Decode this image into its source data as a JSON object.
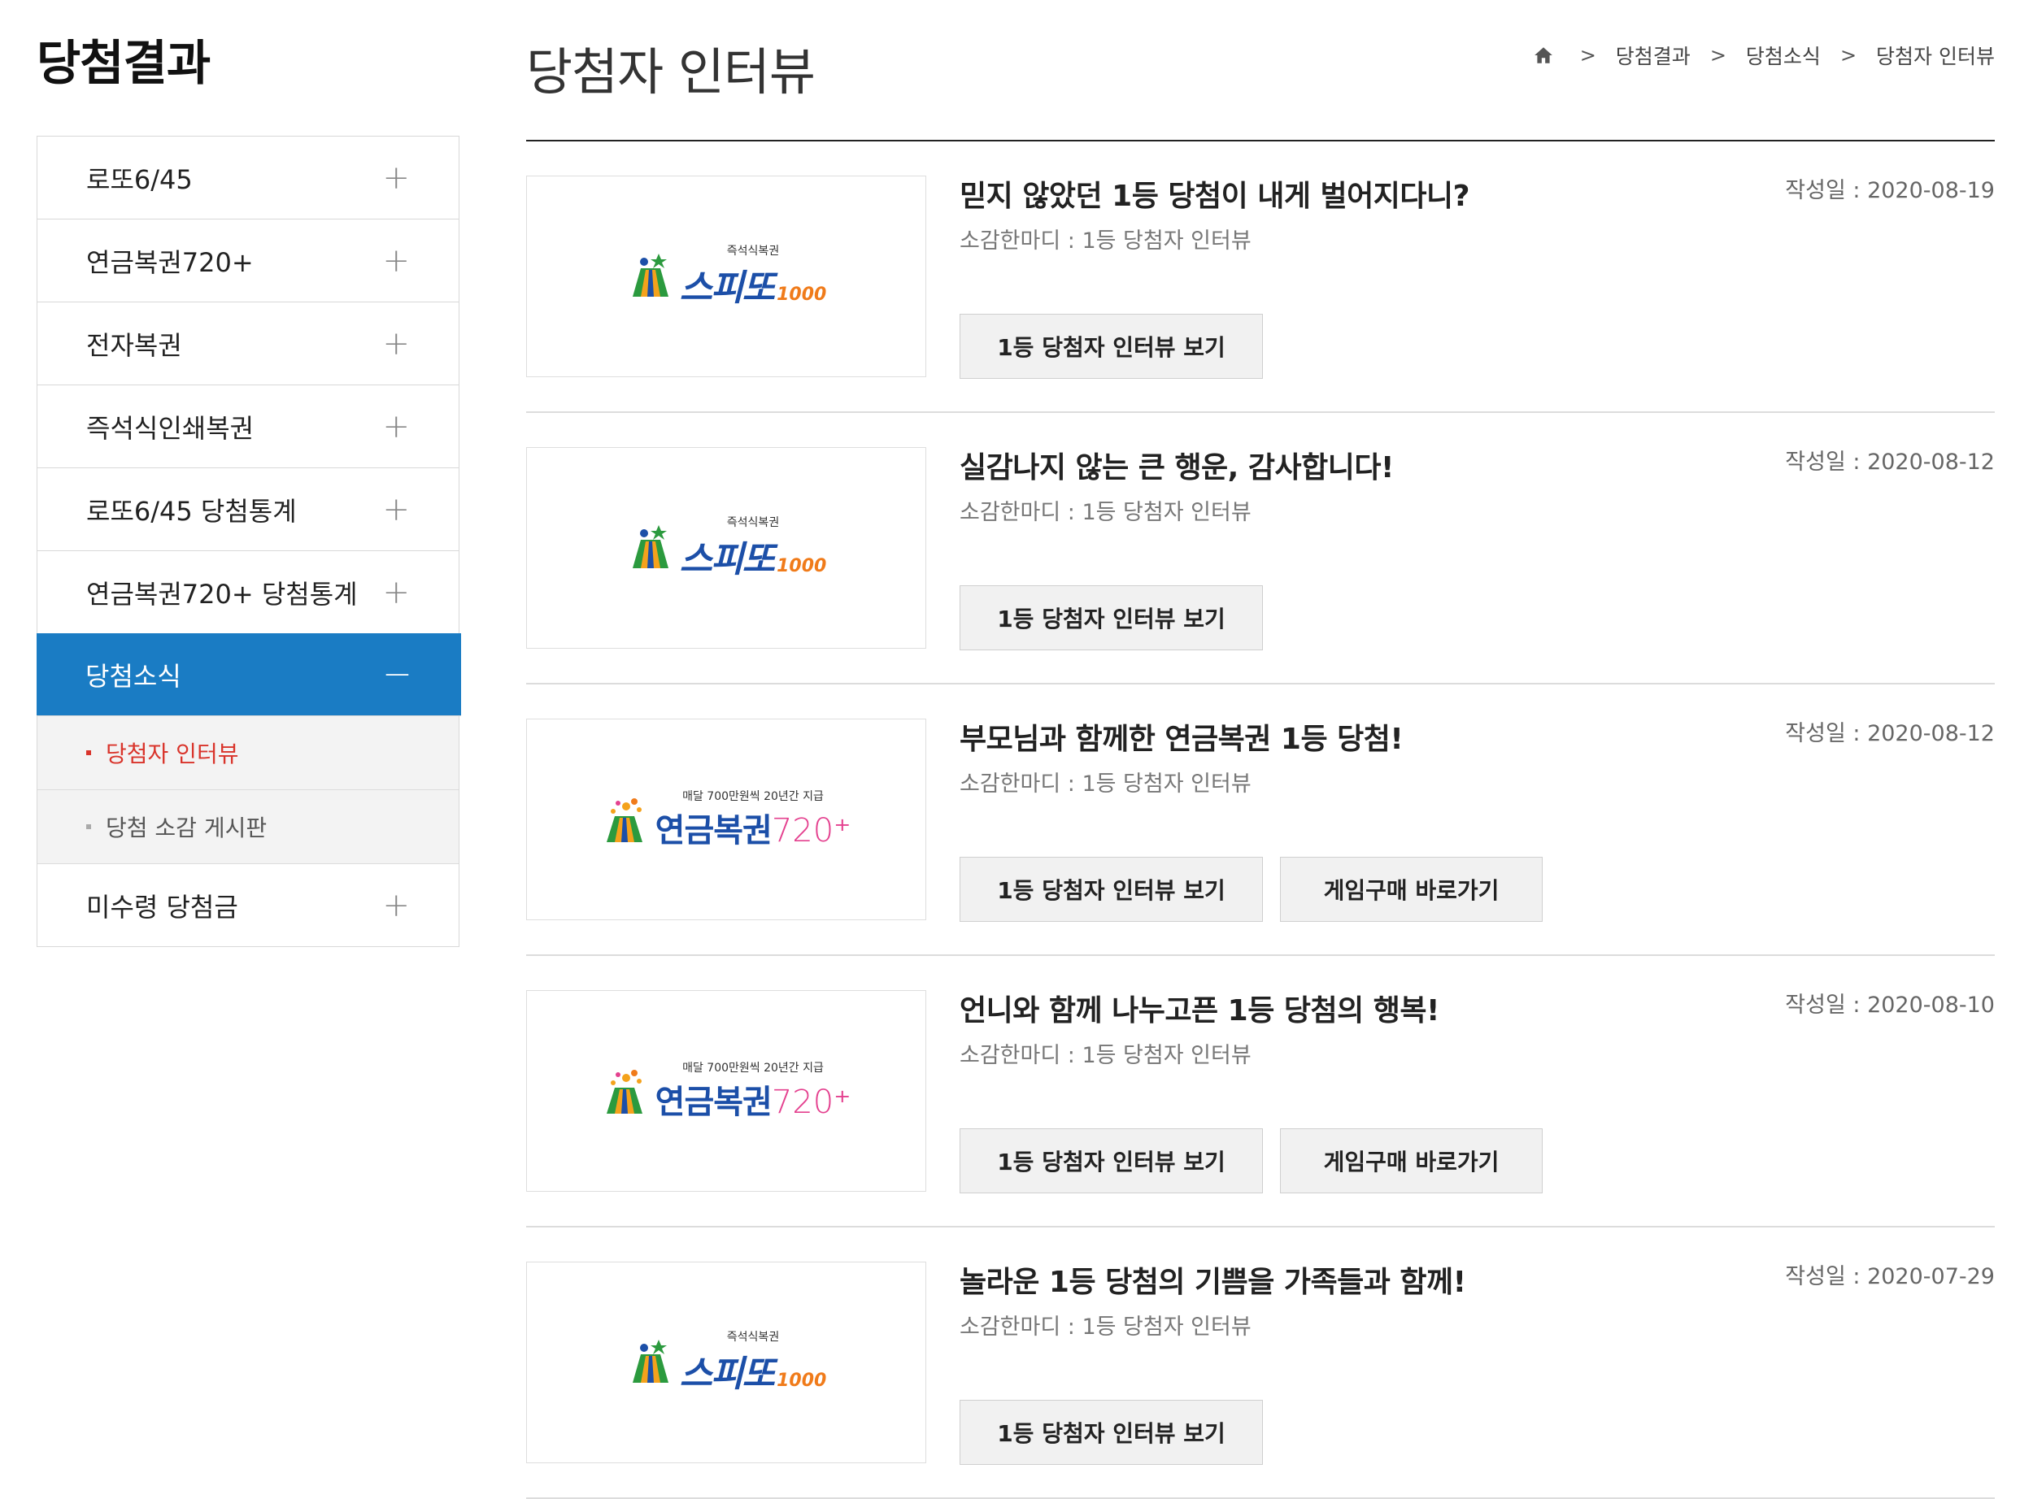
{
  "side_title": "당첨결과",
  "page_title": "당첨자 인터뷰",
  "breadcrumb": {
    "items": [
      "당첨결과",
      "당첨소식",
      "당첨자 인터뷰"
    ]
  },
  "sidebar": {
    "items": [
      {
        "label": "로또6/45"
      },
      {
        "label": "연금복권720+"
      },
      {
        "label": "전자복권"
      },
      {
        "label": "즉석식인쇄복권"
      },
      {
        "label": "로또6/45 당첨통계"
      },
      {
        "label": "연금복권720+ 당첨통계"
      },
      {
        "label": "당첨소식"
      },
      {
        "label": "미수령 당첨금"
      }
    ],
    "sub_items": [
      {
        "label": "당첨자 인터뷰"
      },
      {
        "label": "당첨 소감 게시판"
      }
    ]
  },
  "logos": {
    "speetto": {
      "small": "즉석식복권",
      "big": "스피또",
      "num": "1000"
    },
    "pension": {
      "small": "매달 700만원씩 20년간 지급",
      "big": "연금복권",
      "num": "720⁺"
    }
  },
  "interviews": [
    {
      "title": "믿지 않았던 1등 당첨이 내게 벌어지다니?",
      "sub": "소감한마디 : 1등 당첨자 인터뷰",
      "date": "작성일 : 2020-08-19",
      "btn1": "1등 당첨자 인터뷰 보기",
      "logo": "speetto"
    },
    {
      "title": "실감나지 않는 큰 행운, 감사합니다!",
      "sub": "소감한마디 : 1등 당첨자 인터뷰",
      "date": "작성일 : 2020-08-12",
      "btn1": "1등 당첨자 인터뷰 보기",
      "logo": "speetto"
    },
    {
      "title": "부모님과 함께한 연금복권 1등 당첨!",
      "sub": "소감한마디 : 1등 당첨자 인터뷰",
      "date": "작성일 : 2020-08-12",
      "btn1": "1등 당첨자 인터뷰 보기",
      "btn2": "게임구매 바로가기",
      "logo": "pension"
    },
    {
      "title": "언니와 함께 나누고픈 1등 당첨의 행복!",
      "sub": "소감한마디 : 1등 당첨자 인터뷰",
      "date": "작성일 : 2020-08-10",
      "btn1": "1등 당첨자 인터뷰 보기",
      "btn2": "게임구매 바로가기",
      "logo": "pension"
    },
    {
      "title": "놀라운 1등 당첨의 기쁨을 가족들과 함께!",
      "sub": "소감한마디 : 1등 당첨자 인터뷰",
      "date": "작성일 : 2020-07-29",
      "btn1": "1등 당첨자 인터뷰 보기",
      "logo": "speetto"
    }
  ]
}
